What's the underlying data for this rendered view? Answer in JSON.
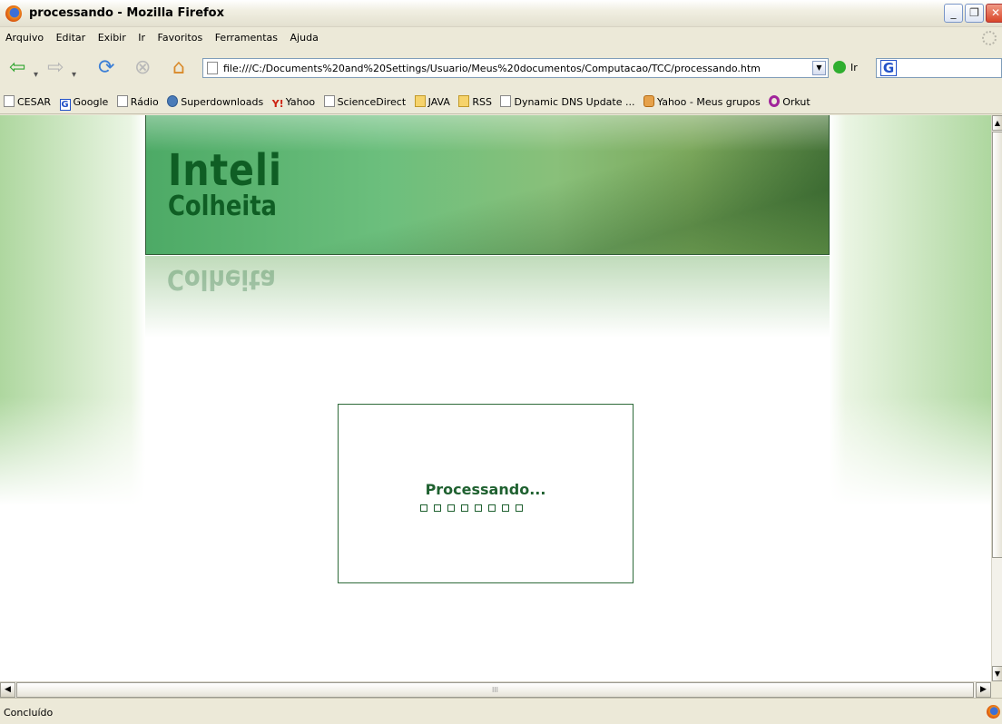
{
  "window": {
    "title": "processando - Mozilla Firefox",
    "buttons": {
      "minimize": "_",
      "maximize": "❐",
      "close": "✕"
    }
  },
  "menu": [
    "Arquivo",
    "Editar",
    "Exibir",
    "Ir",
    "Favoritos",
    "Ferramentas",
    "Ajuda"
  ],
  "navbar": {
    "url": "file:///C:/Documents%20and%20Settings/Usuario/Meus%20documentos/Computacao/TCC/processando.htm",
    "go_label": "Ir",
    "search_engine": "G"
  },
  "bookmarks": [
    {
      "label": "CESAR",
      "icon": "page-icon"
    },
    {
      "label": "Google",
      "icon": "google-icon"
    },
    {
      "label": "Rádio",
      "icon": "page-icon"
    },
    {
      "label": "Superdownloads",
      "icon": "globe-icon"
    },
    {
      "label": "Yahoo",
      "icon": "yahoo-icon"
    },
    {
      "label": "ScienceDirect",
      "icon": "page-icon"
    },
    {
      "label": "JAVA",
      "icon": "folder-icon"
    },
    {
      "label": "RSS",
      "icon": "folder-icon"
    },
    {
      "label": "Dynamic DNS Update ...",
      "icon": "page-icon"
    },
    {
      "label": "Yahoo - Meus grupos",
      "icon": "people-icon"
    },
    {
      "label": "Orkut",
      "icon": "orkut-icon"
    }
  ],
  "page": {
    "logo_line1": "Inteli",
    "logo_line2": "Colheita",
    "processing_text": "Processando...",
    "progress_squares": 8
  },
  "scrollbar_hthumb": "III",
  "status": "Concluído",
  "colors": {
    "brand_green": "#0f5e24",
    "accent_green": "#1f6130"
  }
}
